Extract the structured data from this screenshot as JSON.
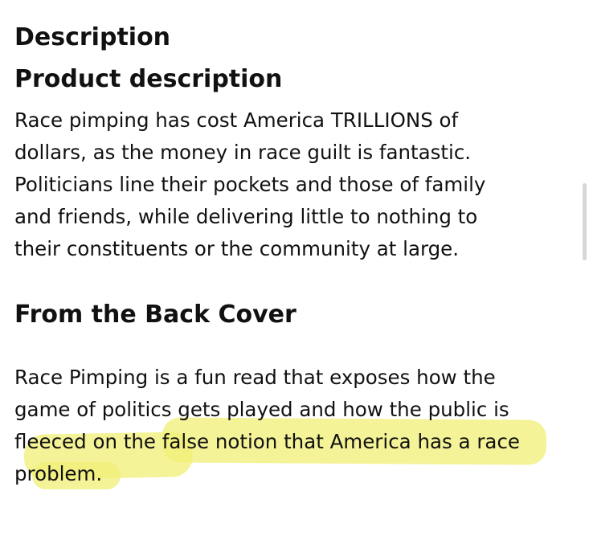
{
  "description_heading": "Description",
  "product_description": {
    "heading": "Product description",
    "lines": [
      "Race pimping has cost America TRILLIONS of",
      "dollars, as the money in race guilt is fantastic.",
      "Politicians line their pockets and those of family",
      "and friends, while delivering little to nothing to",
      "their constituents or the community at large."
    ]
  },
  "back_cover": {
    "heading": "From the Back Cover",
    "lines": [
      "Race Pimping is a fun read that exposes how the",
      "game of politics gets played and how the public is",
      "fleeced on the false notion that America has a race",
      "problem."
    ]
  },
  "colors": {
    "highlight": "#f1ef7a",
    "text": "#111111",
    "background": "#ffffff"
  }
}
